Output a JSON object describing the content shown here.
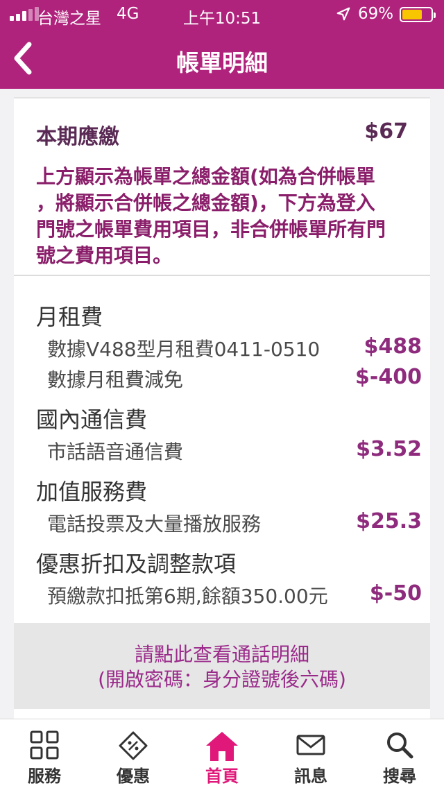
{
  "status_bar": {
    "carrier": "台灣之星",
    "network": "4G",
    "time": "上午10:51",
    "battery_percent": "69%",
    "battery_level": 0.69,
    "battery_color": "#f7c600"
  },
  "nav": {
    "title": "帳單明細",
    "back_icon": "chevron-left-icon"
  },
  "due": {
    "label": "本期應繳",
    "amount": "$67",
    "note_lines": [
      "上方顯示為帳單之總金額(如為合併帳單",
      "，將顯示合併帳之總金額)，下方為登入",
      "門號之帳單費用項目，非合併帳單所有門",
      "號之費用項目。"
    ]
  },
  "sections": [
    {
      "title": "月租費",
      "items": [
        {
          "name": "數據V488型月租費0411-0510",
          "amount": "$488"
        },
        {
          "name": "數據月租費減免",
          "amount": "$-400"
        }
      ]
    },
    {
      "title": "國內通信費",
      "items": [
        {
          "name": "市話語音通信費",
          "amount": "$3.52"
        }
      ]
    },
    {
      "title": "加值服務費",
      "items": [
        {
          "name": "電話投票及大量播放服務",
          "amount": "$25.3"
        }
      ]
    },
    {
      "title": "優惠折扣及調整款項",
      "items": [
        {
          "name": "預繳款扣抵第6期,餘額350.00元",
          "amount": "$-50"
        }
      ]
    }
  ],
  "call_detail": {
    "line1": "請點此查看通話明細",
    "line2": "(開啟密碼：身分證號後六碼)"
  },
  "tabs": [
    {
      "label": "服務",
      "icon": "grid-icon",
      "active": false
    },
    {
      "label": "優惠",
      "icon": "discount-tag-icon",
      "active": false
    },
    {
      "label": "首頁",
      "icon": "home-icon",
      "active": true
    },
    {
      "label": "訊息",
      "icon": "envelope-icon",
      "active": false
    },
    {
      "label": "搜尋",
      "icon": "search-icon",
      "active": false
    }
  ],
  "colors": {
    "brand": "#b0237c",
    "accent": "#e0187a",
    "amount": "#8e2b7d"
  }
}
